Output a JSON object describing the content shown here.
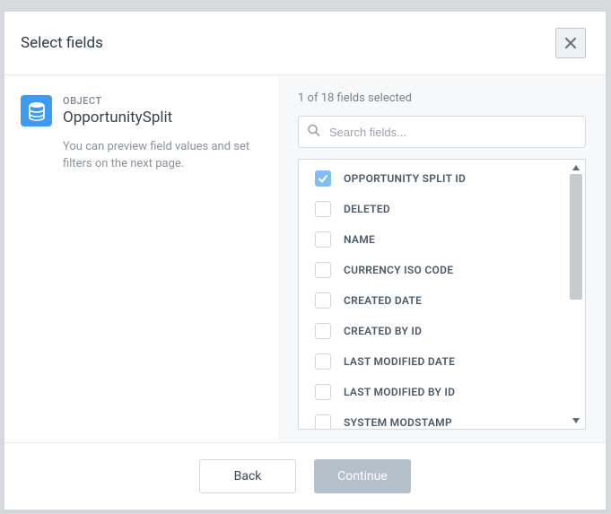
{
  "header": {
    "title": "Select fields"
  },
  "object": {
    "label": "OBJECT",
    "name": "OpportunitySplit",
    "description": "You can preview field values and set filters on the next page."
  },
  "fields_panel": {
    "count_text": "1 of 18 fields selected",
    "search_placeholder": "Search fields...",
    "fields": [
      {
        "label": "OPPORTUNITY SPLIT ID",
        "checked": true
      },
      {
        "label": "DELETED",
        "checked": false
      },
      {
        "label": "NAME",
        "checked": false
      },
      {
        "label": "CURRENCY ISO CODE",
        "checked": false
      },
      {
        "label": "CREATED DATE",
        "checked": false
      },
      {
        "label": "CREATED BY ID",
        "checked": false
      },
      {
        "label": "LAST MODIFIED DATE",
        "checked": false
      },
      {
        "label": "LAST MODIFIED BY ID",
        "checked": false
      },
      {
        "label": "SYSTEM MODSTAMP",
        "checked": false
      }
    ]
  },
  "footer": {
    "back": "Back",
    "continue": "Continue"
  }
}
